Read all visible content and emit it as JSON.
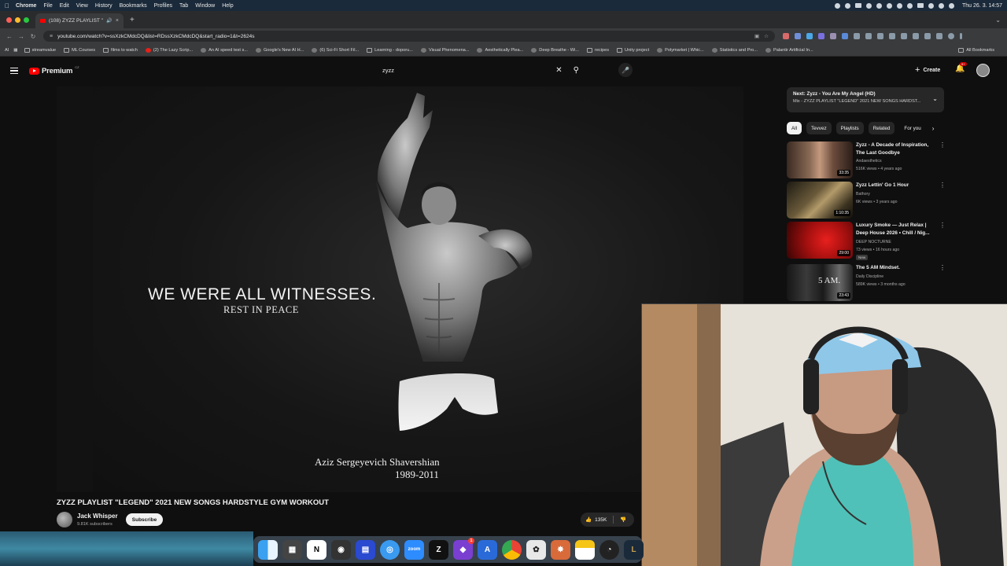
{
  "menubar": {
    "app": "Chrome",
    "items": [
      "File",
      "Edit",
      "View",
      "History",
      "Bookmarks",
      "Profiles",
      "Tab",
      "Window",
      "Help"
    ],
    "clock": "Thu 26. 3.  14:57"
  },
  "tab": {
    "title": "(108) ZYZZ PLAYLIST \"L"
  },
  "address": {
    "url": "youtube.com/watch?v=ssXzkCMdcDQ&list=RDssXzkCMdcDQ&start_radio=1&t=2624s"
  },
  "bookmarks": {
    "items": [
      "streamvalue",
      "ML Courses",
      "films to watch",
      "(2) The Lazy Scrip...",
      "An AI speed test s...",
      "Google's New AI H...",
      "(6) Sci-Fi Short Fil...",
      "Learning - doporu...",
      "Visual Phenomena...",
      "Aesthetically Plea...",
      "Deep Breathe - Wi...",
      "recipes",
      "Unity project",
      "Polymarket | Whic...",
      "Statistics and Pro...",
      "Palantir Artificial In..."
    ],
    "all": "All Bookmarks"
  },
  "youtube": {
    "logo": "Premium",
    "logo_sup": "CZ",
    "search_value": "zyzz",
    "create": "Create",
    "notif_count": "9+"
  },
  "video": {
    "overlay_line1": "WE WERE ALL WITNESSES.",
    "overlay_line2": "REST IN PEACE",
    "name": "Aziz Sergeyevich Shavershian",
    "years": "1989-2011",
    "title": "ZYZZ PLAYLIST \"LEGEND\" 2021 NEW SONGS HARDSTYLE GYM WORKOUT",
    "channel": "Jack Whisper",
    "subscribers": "9.81K subscribers",
    "subscribe": "Subscribe",
    "likes": "135K"
  },
  "sidebar": {
    "next_line1": "Next: Zyzz - You Are My Angel (HD)",
    "next_line2": "Mix - ZYZZ PLAYLIST \"LEGEND\" 2021 NEW SONGS HARDST...",
    "chips": [
      "All",
      "Tevvez",
      "Playlists",
      "Related",
      "For you"
    ],
    "recs": [
      {
        "title": "Zyzz - A Decade of Inspiration, The Last Goodbye",
        "channel": "Andaesthetics",
        "meta": "516K views • 4 years ago",
        "duration": "33:35"
      },
      {
        "title": "Zyzz Lettin' Go 1 Hour",
        "channel": "Bathory",
        "meta": "6K views • 3 years ago",
        "duration": "1:10:35"
      },
      {
        "title": "Luxury Smoke — Just Relax | Deep House 2026 • Chill / Nig...",
        "channel": "DEEP NOCTURNE",
        "meta": "73 views • 16 hours ago",
        "duration": "29:00",
        "badge": "New"
      },
      {
        "title": "The 5 AM Mindset.",
        "channel": "Daily Discipline",
        "meta": "589K views • 3 months ago",
        "duration": "23:43",
        "thumb_text": "5 AM."
      }
    ]
  },
  "dock": {
    "zoom_label": "zoom",
    "notif_badge": "1"
  },
  "colors": {
    "bg": "#0f0f0f",
    "brand_red": "#ff0000",
    "chip_bg": "#272727"
  }
}
